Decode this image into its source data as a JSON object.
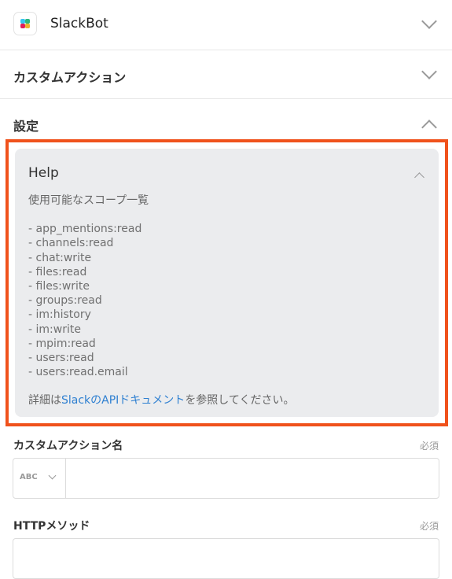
{
  "app": {
    "name": "SlackBot",
    "icon": "slack-logo-icon"
  },
  "sections": {
    "custom_actions": "カスタムアクション",
    "settings": "設定"
  },
  "help": {
    "title": "Help",
    "intro": "使用可能なスコープ一覧",
    "scopes": [
      "- app_mentions:read",
      "- channels:read",
      "- chat:write",
      "- files:read",
      "- files:write",
      "- groups:read",
      "- im:history",
      "- im:write",
      "- mpim:read",
      "- users:read",
      "- users:read.email"
    ],
    "footer_prefix": "詳細は",
    "footer_link": "SlackのAPIドキュメント",
    "footer_suffix": "を参照してください。"
  },
  "fields": {
    "action_name": {
      "label": "カスタムアクション名",
      "required": "必須",
      "type_label": "ABC",
      "value": ""
    },
    "http_method": {
      "label": "HTTPメソッド",
      "required": "必須"
    }
  },
  "colors": {
    "highlight_border": "#f0521c",
    "link": "#2f80d1",
    "help_bg": "#ebecee"
  }
}
